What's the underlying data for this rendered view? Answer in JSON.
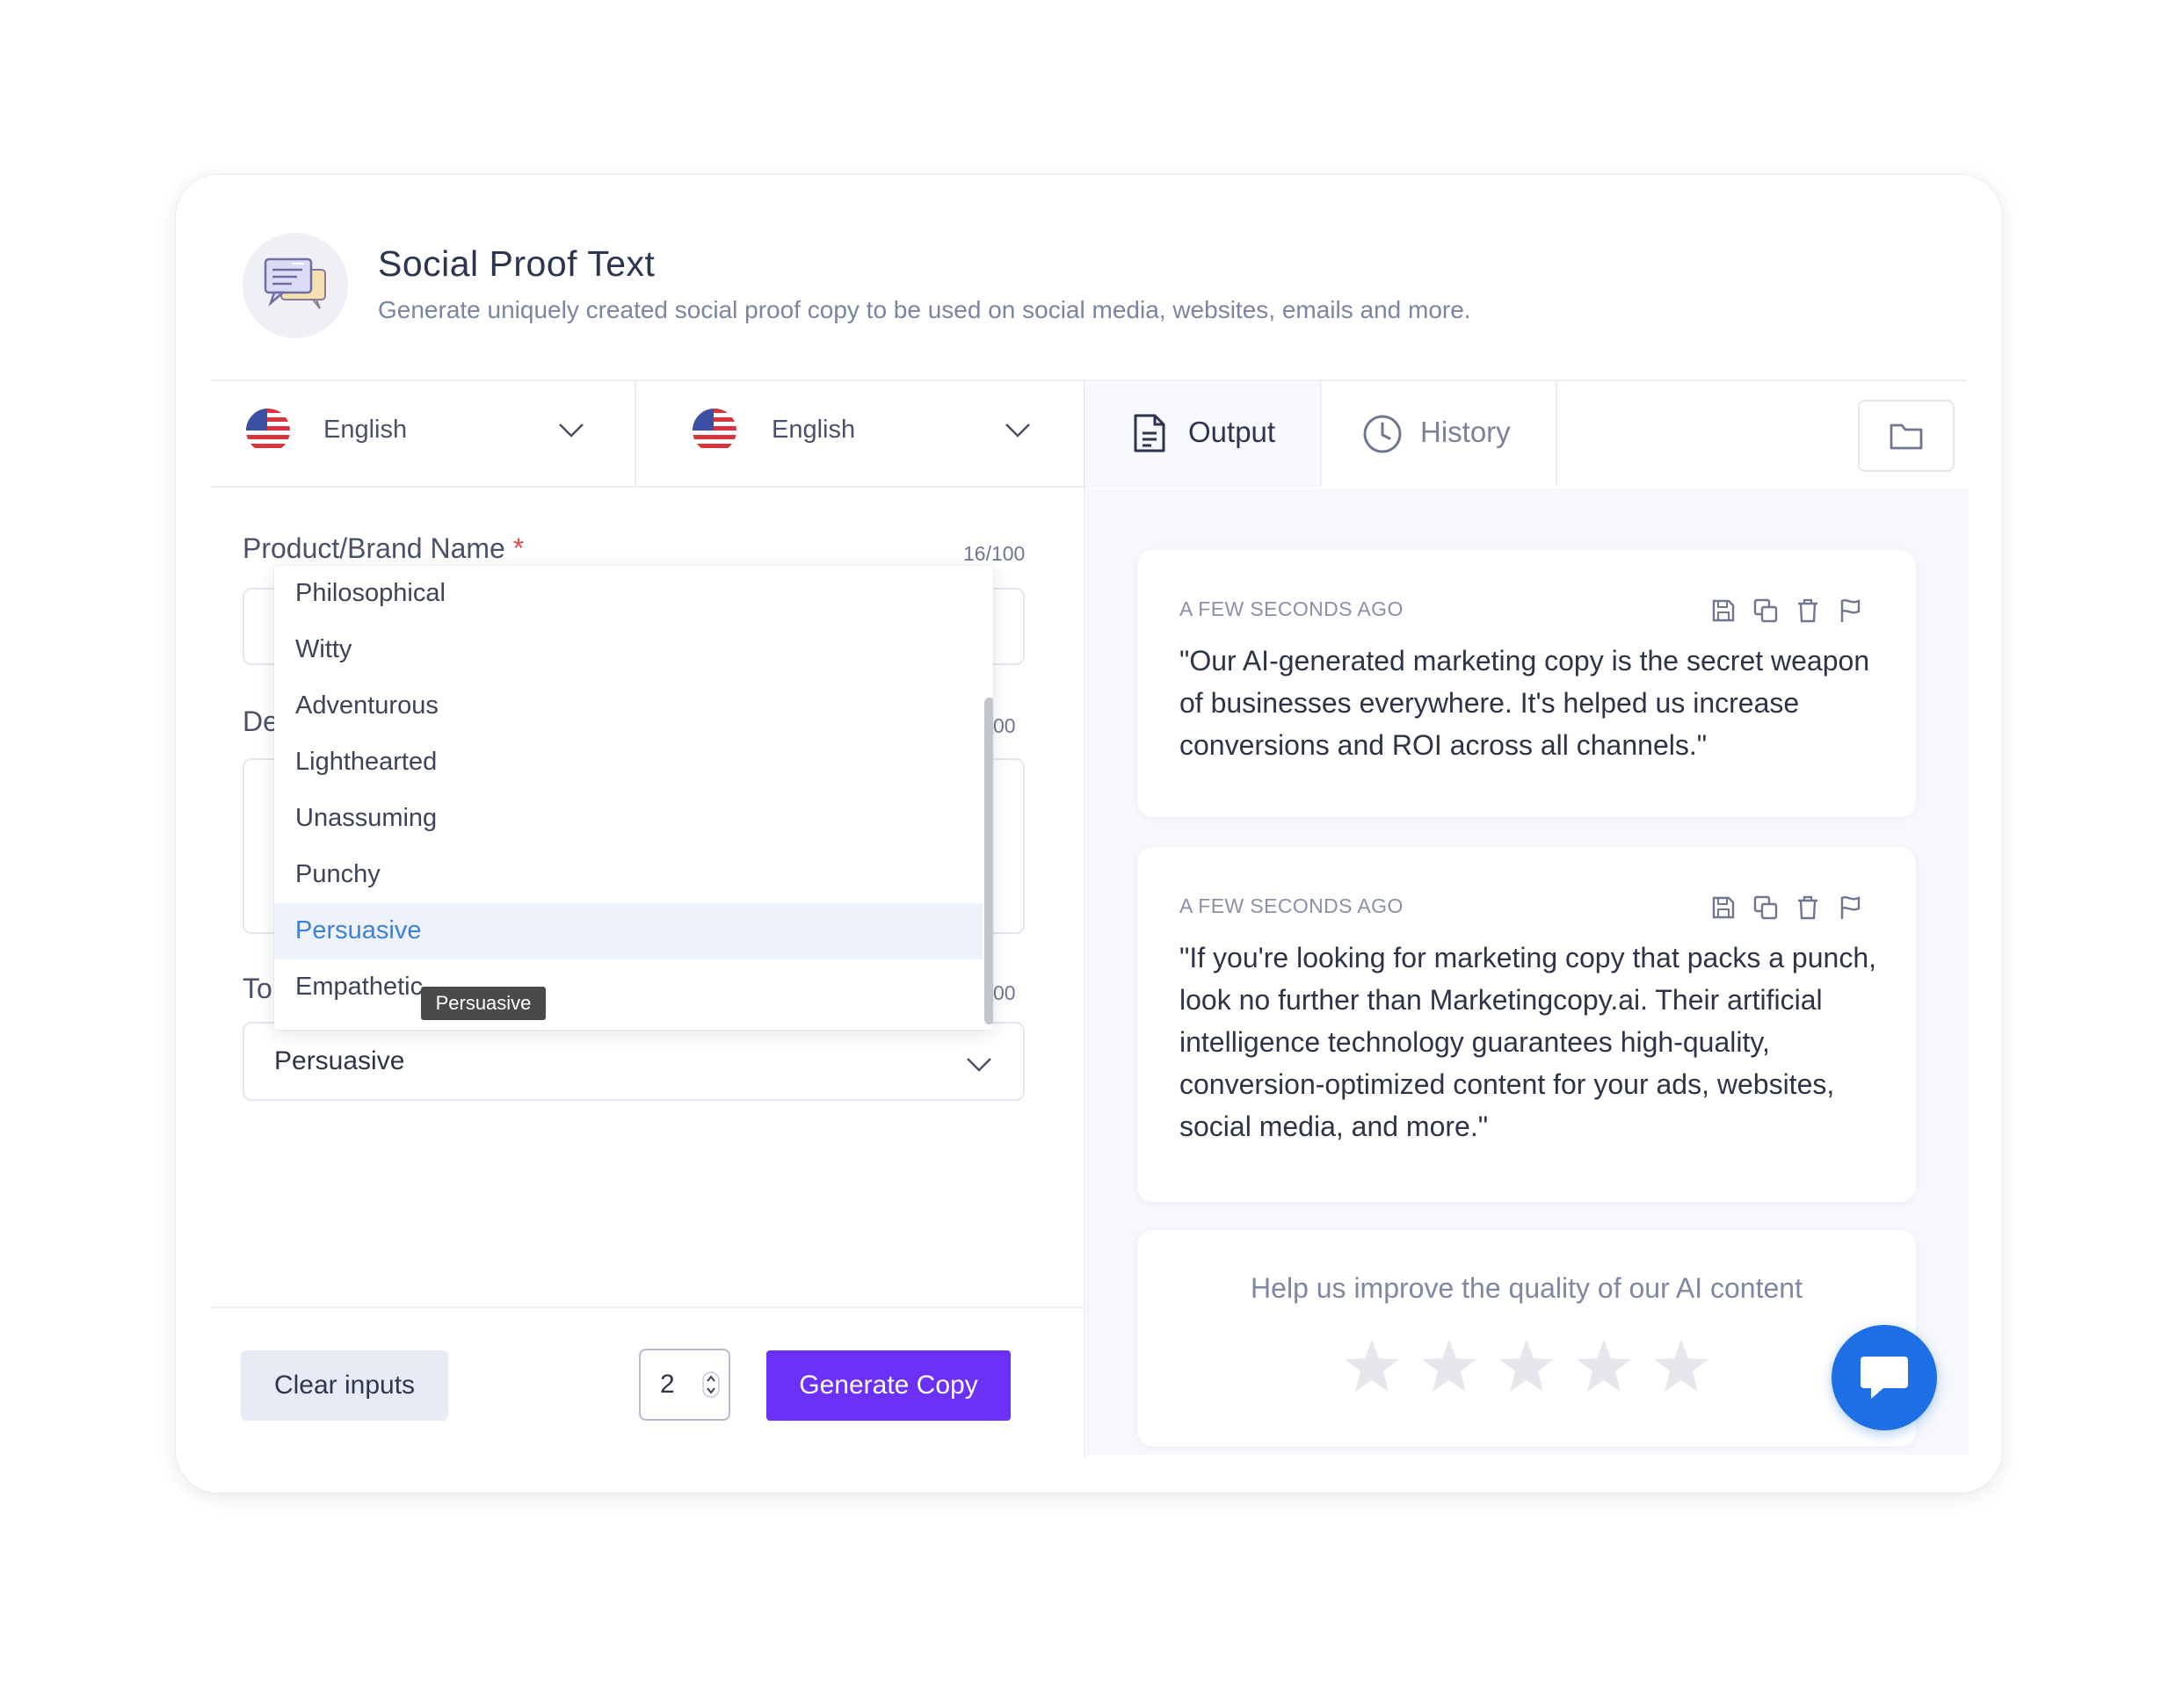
{
  "header": {
    "title": "Social Proof Text",
    "subtitle": "Generate uniquely created social proof copy to be used on social media, websites, emails and more."
  },
  "languages": {
    "input_language": "English",
    "output_language": "English"
  },
  "tabs": [
    {
      "label": "Output",
      "active": true
    },
    {
      "label": "History",
      "active": false
    }
  ],
  "form": {
    "product_label": "Product/Brand Name",
    "required_mark": "*",
    "product_counter": "16/100",
    "description_label_partial": "De",
    "description_counter_partial": "00",
    "tone_label_partial": "To",
    "tone_counter_partial": "00",
    "tone_value": "Persuasive"
  },
  "tone_dropdown": {
    "options": [
      "Philosophical",
      "Witty",
      "Adventurous",
      "Lighthearted",
      "Unassuming",
      "Punchy",
      "Persuasive",
      "Empathetic"
    ],
    "selected": "Persuasive",
    "tooltip": "Persuasive"
  },
  "footer": {
    "clear_label": "Clear inputs",
    "quantity": "2",
    "generate_label": "Generate Copy"
  },
  "outputs": [
    {
      "time": "A FEW SECONDS AGO",
      "text": "\"Our AI-generated marketing copy is the secret weapon of businesses everywhere. It's helped us increase conversions and ROI across all channels.\""
    },
    {
      "time": "A FEW SECONDS AGO",
      "text": "\"If you're looking for marketing copy that packs a punch, look no further than Marketingcopy.ai. Their artificial intelligence technology guarantees high-quality, conversion-optimized content for your ads, websites, social media, and more.\""
    }
  ],
  "rating": {
    "prompt": "Help us improve the quality of our AI content",
    "max_stars": 5,
    "current": 0
  },
  "colors": {
    "accent": "#6c31f9",
    "chat": "#1e6fe6",
    "selected_text": "#3f7fdc"
  },
  "icons": [
    "app-chat-icon",
    "us-flag-icon",
    "chevron-down-icon",
    "document-icon",
    "clock-icon",
    "folder-icon",
    "save-icon",
    "copy-icon",
    "trash-icon",
    "flag-icon",
    "star-icon",
    "chat-bubble-icon"
  ]
}
